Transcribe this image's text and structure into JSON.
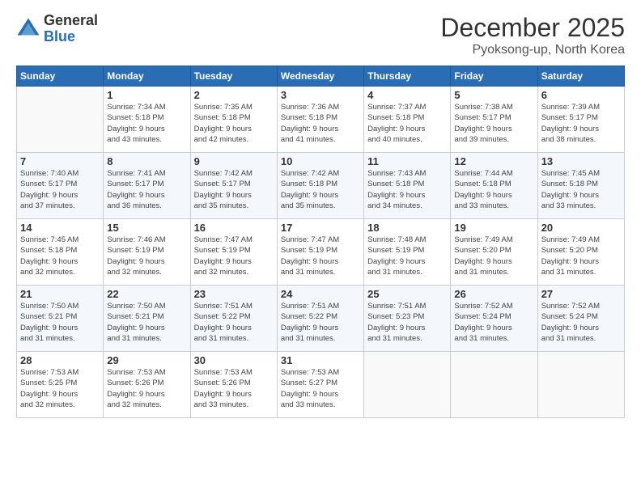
{
  "logo": {
    "general": "General",
    "blue": "Blue"
  },
  "header": {
    "month": "December 2025",
    "location": "Pyoksong-up, North Korea"
  },
  "weekdays": [
    "Sunday",
    "Monday",
    "Tuesday",
    "Wednesday",
    "Thursday",
    "Friday",
    "Saturday"
  ],
  "weeks": [
    [
      {
        "day": "",
        "info": ""
      },
      {
        "day": "1",
        "info": "Sunrise: 7:34 AM\nSunset: 5:18 PM\nDaylight: 9 hours\nand 43 minutes."
      },
      {
        "day": "2",
        "info": "Sunrise: 7:35 AM\nSunset: 5:18 PM\nDaylight: 9 hours\nand 42 minutes."
      },
      {
        "day": "3",
        "info": "Sunrise: 7:36 AM\nSunset: 5:18 PM\nDaylight: 9 hours\nand 41 minutes."
      },
      {
        "day": "4",
        "info": "Sunrise: 7:37 AM\nSunset: 5:18 PM\nDaylight: 9 hours\nand 40 minutes."
      },
      {
        "day": "5",
        "info": "Sunrise: 7:38 AM\nSunset: 5:17 PM\nDaylight: 9 hours\nand 39 minutes."
      },
      {
        "day": "6",
        "info": "Sunrise: 7:39 AM\nSunset: 5:17 PM\nDaylight: 9 hours\nand 38 minutes."
      }
    ],
    [
      {
        "day": "7",
        "info": "Sunrise: 7:40 AM\nSunset: 5:17 PM\nDaylight: 9 hours\nand 37 minutes."
      },
      {
        "day": "8",
        "info": "Sunrise: 7:41 AM\nSunset: 5:17 PM\nDaylight: 9 hours\nand 36 minutes."
      },
      {
        "day": "9",
        "info": "Sunrise: 7:42 AM\nSunset: 5:17 PM\nDaylight: 9 hours\nand 35 minutes."
      },
      {
        "day": "10",
        "info": "Sunrise: 7:42 AM\nSunset: 5:18 PM\nDaylight: 9 hours\nand 35 minutes."
      },
      {
        "day": "11",
        "info": "Sunrise: 7:43 AM\nSunset: 5:18 PM\nDaylight: 9 hours\nand 34 minutes."
      },
      {
        "day": "12",
        "info": "Sunrise: 7:44 AM\nSunset: 5:18 PM\nDaylight: 9 hours\nand 33 minutes."
      },
      {
        "day": "13",
        "info": "Sunrise: 7:45 AM\nSunset: 5:18 PM\nDaylight: 9 hours\nand 33 minutes."
      }
    ],
    [
      {
        "day": "14",
        "info": "Sunrise: 7:45 AM\nSunset: 5:18 PM\nDaylight: 9 hours\nand 32 minutes."
      },
      {
        "day": "15",
        "info": "Sunrise: 7:46 AM\nSunset: 5:19 PM\nDaylight: 9 hours\nand 32 minutes."
      },
      {
        "day": "16",
        "info": "Sunrise: 7:47 AM\nSunset: 5:19 PM\nDaylight: 9 hours\nand 32 minutes."
      },
      {
        "day": "17",
        "info": "Sunrise: 7:47 AM\nSunset: 5:19 PM\nDaylight: 9 hours\nand 31 minutes."
      },
      {
        "day": "18",
        "info": "Sunrise: 7:48 AM\nSunset: 5:19 PM\nDaylight: 9 hours\nand 31 minutes."
      },
      {
        "day": "19",
        "info": "Sunrise: 7:49 AM\nSunset: 5:20 PM\nDaylight: 9 hours\nand 31 minutes."
      },
      {
        "day": "20",
        "info": "Sunrise: 7:49 AM\nSunset: 5:20 PM\nDaylight: 9 hours\nand 31 minutes."
      }
    ],
    [
      {
        "day": "21",
        "info": "Sunrise: 7:50 AM\nSunset: 5:21 PM\nDaylight: 9 hours\nand 31 minutes."
      },
      {
        "day": "22",
        "info": "Sunrise: 7:50 AM\nSunset: 5:21 PM\nDaylight: 9 hours\nand 31 minutes."
      },
      {
        "day": "23",
        "info": "Sunrise: 7:51 AM\nSunset: 5:22 PM\nDaylight: 9 hours\nand 31 minutes."
      },
      {
        "day": "24",
        "info": "Sunrise: 7:51 AM\nSunset: 5:22 PM\nDaylight: 9 hours\nand 31 minutes."
      },
      {
        "day": "25",
        "info": "Sunrise: 7:51 AM\nSunset: 5:23 PM\nDaylight: 9 hours\nand 31 minutes."
      },
      {
        "day": "26",
        "info": "Sunrise: 7:52 AM\nSunset: 5:24 PM\nDaylight: 9 hours\nand 31 minutes."
      },
      {
        "day": "27",
        "info": "Sunrise: 7:52 AM\nSunset: 5:24 PM\nDaylight: 9 hours\nand 31 minutes."
      }
    ],
    [
      {
        "day": "28",
        "info": "Sunrise: 7:53 AM\nSunset: 5:25 PM\nDaylight: 9 hours\nand 32 minutes."
      },
      {
        "day": "29",
        "info": "Sunrise: 7:53 AM\nSunset: 5:26 PM\nDaylight: 9 hours\nand 32 minutes."
      },
      {
        "day": "30",
        "info": "Sunrise: 7:53 AM\nSunset: 5:26 PM\nDaylight: 9 hours\nand 33 minutes."
      },
      {
        "day": "31",
        "info": "Sunrise: 7:53 AM\nSunset: 5:27 PM\nDaylight: 9 hours\nand 33 minutes."
      },
      {
        "day": "",
        "info": ""
      },
      {
        "day": "",
        "info": ""
      },
      {
        "day": "",
        "info": ""
      }
    ]
  ]
}
